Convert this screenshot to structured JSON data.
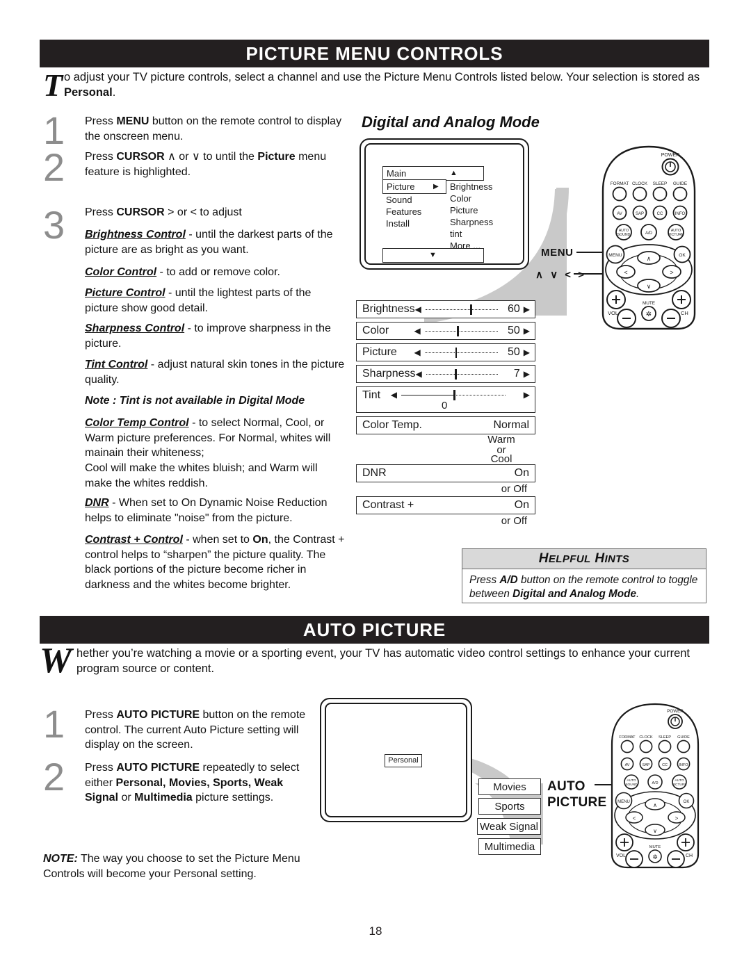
{
  "page": {
    "number": "18"
  },
  "sections": {
    "picture_menu": {
      "title": "PICTURE MENU CONTROLS",
      "intro_cap": "T",
      "intro": "o adjust your TV picture controls, select a channel and use the Picture Menu Controls listed below. Your selection is stored as Personal.",
      "intro_part1": "o adjust your TV picture controls, select a channel and use the Picture Menu Controls listed below. Your selection is stored as ",
      "intro_bold": "Personal",
      "intro_part2": ".",
      "steps": [
        {
          "num": "1",
          "text_pre": "Press ",
          "text_bold": "MENU",
          "text_post": " button on the remote control to display the onscreen menu."
        },
        {
          "num": "2",
          "text_pre": "Press ",
          "text_bold": "CURSOR",
          "mid": "  ∧  or ∨ to until the ",
          "bold2": "Picture",
          "text_post": " menu feature is highlighted."
        },
        {
          "num": "3",
          "text_pre": "Press ",
          "text_bold": "CURSOR",
          "mid": "  >  or  < to adjust"
        }
      ],
      "controls": [
        {
          "name": "Brightness Control",
          "desc": " - until the darkest parts of the picture are as bright as you want."
        },
        {
          "name": "Color Control",
          "desc": " -  to add or remove color."
        },
        {
          "name": "Picture Control",
          "desc": " -  until the lightest parts of the picture show good detail."
        },
        {
          "name": "Sharpness Control",
          "desc": " -  to improve sharpness in the picture."
        },
        {
          "name": "Tint Control",
          "desc": " - adjust natural skin tones in the picture quality."
        }
      ],
      "tint_note": "Note : Tint is not available in Digital Mode",
      "color_temp": {
        "name": "Color Temp Control",
        "desc": " -  to select Normal, Cool, or Warm picture preferences.  For Normal, whites will mainain their whiteness;",
        "desc2": "Cool will make the whites bluish; and Warm will make the whites reddish."
      },
      "dnr": {
        "name": "DNR",
        "desc": " - When set to On Dynamic Noise Reduction helps to eliminate \"noise\" from the picture."
      },
      "contrast": {
        "name": "Contrast + Control",
        "desc_pre": " -   when set to ",
        "desc_bold": "On",
        "desc_post": ", the Contrast + control helps to “sharpen” the picture quality. The black portions of the picture become richer in darkness and the whites become brighter."
      }
    },
    "auto_picture": {
      "title": "AUTO PICTURE",
      "intro_cap": "W",
      "intro": "hether you’re watching a movie or a sporting event, your TV has automatic video control settings to enhance your current program source or content.",
      "steps": [
        {
          "num": "1",
          "text_pre": "Press ",
          "text_bold": "AUTO PICTURE",
          "text_post": " button on the remote control. The current Auto Picture setting will display on the screen."
        },
        {
          "num": "2",
          "text_pre": "Press ",
          "text_bold": "AUTO PICTURE",
          "text_post": " repeatedly to select either "
        }
      ],
      "step2_options_bold": "Personal, Movies, Sports, Weak Signal",
      "step2_or": " or ",
      "step2_options_bold2": "Multimedia",
      "step2_tail": " picture settings.",
      "note": {
        "label": "NOTE:",
        "text": " The way you choose to set the Picture Menu Controls will become your Personal setting."
      },
      "screen_label": "Personal",
      "options": [
        "Movies",
        "Sports",
        "Weak Signal",
        "Multimedia"
      ],
      "remote_callout": "AUTO PICTURE",
      "remote_callout_line1": "AUTO",
      "remote_callout_line2": "PICTURE"
    }
  },
  "digital_analog": {
    "heading": "Digital and Analog Mode",
    "osd_menu": {
      "top_row": {
        "label": "Main",
        "arrow": "▲"
      },
      "left_items": [
        {
          "label": "Picture",
          "arrow": "▶",
          "highlighted": true
        },
        {
          "label": "Sound",
          "arrow": "",
          "highlighted": false
        },
        {
          "label": "Features",
          "arrow": "",
          "highlighted": false
        },
        {
          "label": "Install",
          "arrow": "",
          "highlighted": false
        }
      ],
      "right_items": [
        "Brightness",
        "Color",
        "Picture",
        "Sharpness",
        "tint",
        "More ..."
      ],
      "bottom_row": {
        "arrow": "▼"
      }
    },
    "sliders": [
      {
        "label": "Brightness",
        "value": "60",
        "pos": 62,
        "dotted_left": true
      },
      {
        "label": "Color",
        "value": "50",
        "pos": 44,
        "dotted_left": true
      },
      {
        "label": "Picture",
        "value": "50",
        "pos": 42,
        "dotted_left": true
      },
      {
        "label": "Sharpness",
        "value": "7",
        "pos": 40,
        "dotted_left": true
      },
      {
        "label": "Tint",
        "value": "0",
        "pos": 50,
        "dotted_left": false
      }
    ],
    "arrow_left": "◀",
    "arrow_right": "▶",
    "value_rows": [
      {
        "label": "Color Temp.",
        "value": "Normal",
        "sub": "Warm\nor\nCool"
      },
      {
        "label": "DNR",
        "value": "On",
        "sub": "or Off"
      },
      {
        "label": "Contrast +",
        "value": "On",
        "sub": "or Off"
      }
    ],
    "color_temp_sub": [
      "Warm",
      "or",
      "Cool"
    ],
    "dnr_sub": "or Off",
    "contrast_sub": "or Off"
  },
  "helpful_hints": {
    "title_h": "H",
    "title_elpful": "ELPFUL",
    "title_h2": "H",
    "title_ints": "INTS",
    "title": "HELPFUL HINTS",
    "body_pre": "Press ",
    "body_bold": "A/D",
    "body_mid": " button on the remote control to toggle between ",
    "body_bold2": "Digital and Analog Mode",
    "body_post": "."
  },
  "remote": {
    "power_label": "POWER",
    "row1": [
      "FORMAT",
      "CLOCK",
      "SLEEP",
      "GUIDE"
    ],
    "row2": [
      "AV",
      "SAP",
      "CC",
      "INFO"
    ],
    "row3": [
      "AUTO SOUND",
      "A/D",
      "AUTO PICTURE"
    ],
    "menu_label": "MENU",
    "ok_label": "OK",
    "vol_label": "VOL",
    "ch_label": "CH",
    "mute_label": "MUTE",
    "cursor_up": "∧",
    "cursor_down": "∨",
    "cursor_left": "<",
    "cursor_right": ">",
    "callout_menu": "MENU",
    "callout_cursor": "∧  ∨  <  >"
  },
  "colors": {
    "banner_bg": "#231f20",
    "banner_text": "#ffffff",
    "step_number": "#8d8d8d",
    "swoosh": "#c9c9c9",
    "hints_header": "#d9d9d9",
    "ink": "#1a1a1a"
  }
}
